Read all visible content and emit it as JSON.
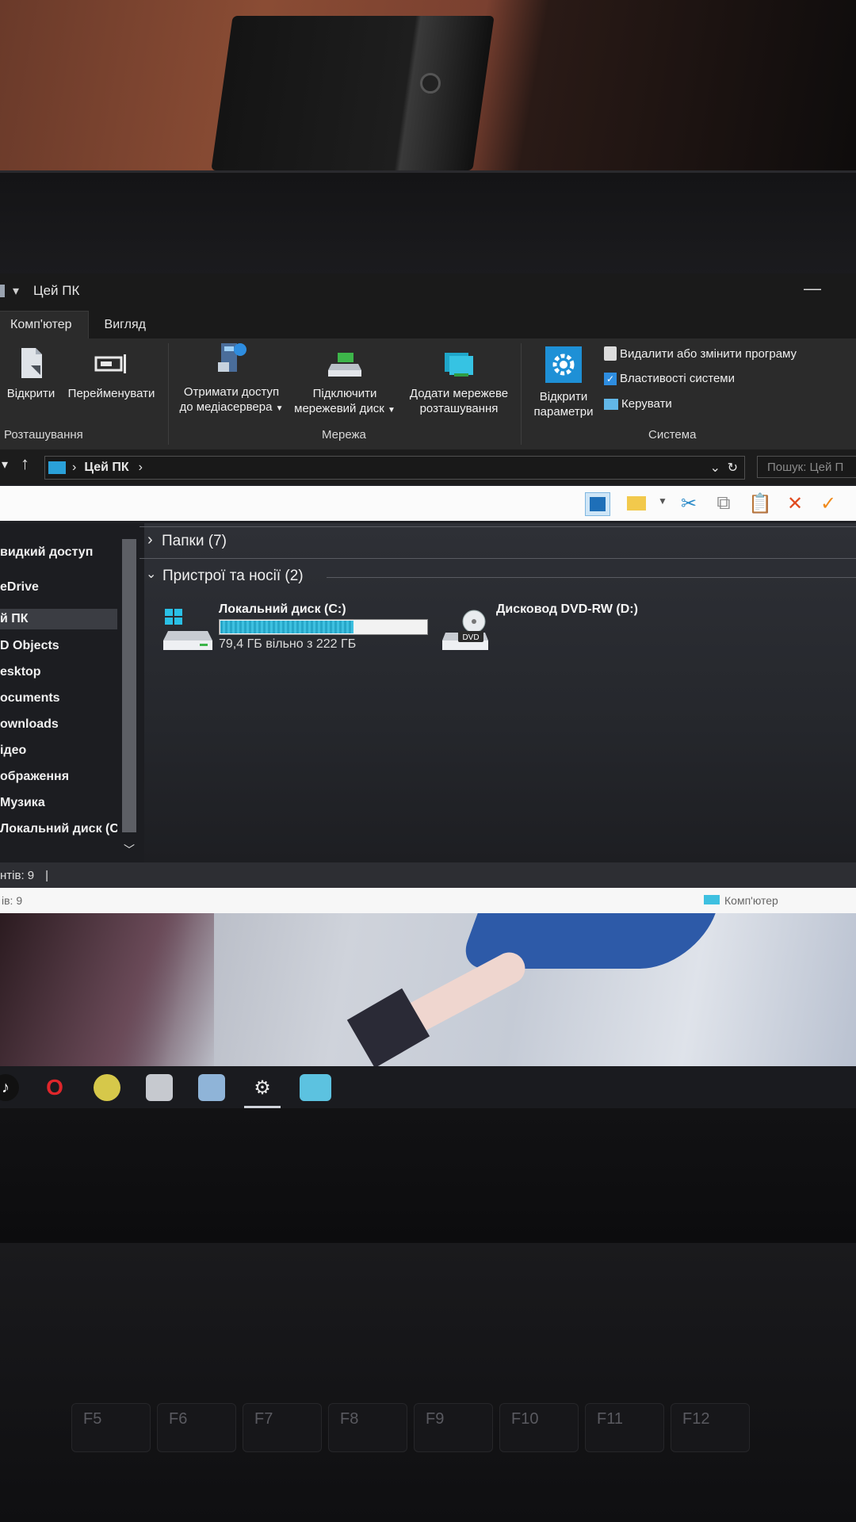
{
  "window": {
    "title": "Цей ПК",
    "qa_dropdown": "▾"
  },
  "tabs": [
    {
      "label": "Комп'ютер"
    },
    {
      "label": "Вигляд"
    }
  ],
  "ribbon": {
    "open_label": "Відкрити",
    "rename_label": "Перейменувати",
    "location_group": "Розташування",
    "media_l1": "Отримати доступ",
    "media_l2": "до медіасервера",
    "map_l1": "Підключити",
    "map_l2": "мережевий диск",
    "addloc_l1": "Додати мережеве",
    "addloc_l2": "розташування",
    "network_group": "Мережа",
    "settings_l1": "Відкрити",
    "settings_l2": "параметри",
    "uninstall_label": "Видалити або змінити програму",
    "sysprops_label": "Властивості системи",
    "manage_label": "Керувати",
    "system_group": "Система"
  },
  "address": {
    "path": "Цей ПК",
    "search_placeholder": "Пошук: Цей П"
  },
  "nav": {
    "items": [
      {
        "label": "видкий доступ"
      },
      {
        "label": "eDrive"
      },
      {
        "label": "й ПК"
      },
      {
        "label": "D Objects"
      },
      {
        "label": "esktop"
      },
      {
        "label": "ocuments"
      },
      {
        "label": "ownloads"
      },
      {
        "label": "ідео"
      },
      {
        "label": "ображення"
      },
      {
        "label": "Музика"
      },
      {
        "label": "Локальний диск (C:)"
      }
    ]
  },
  "content": {
    "folders_header": "Папки (7)",
    "devices_header": "Пристрої та носії (2)",
    "drive_c": {
      "name": "Локальний диск (C:)",
      "free_text": "79,4 ГБ вільно з 222 ГБ",
      "used_fraction": 0.64
    },
    "drive_d": {
      "name": "Дисковод DVD-RW (D:)",
      "badge": "DVD"
    }
  },
  "status": {
    "items_text": "нтів: 9",
    "items_text2": "ів: 9",
    "computer_label": "Комп'ютер"
  },
  "keyboard": {
    "fkeys": [
      "F5",
      "F6",
      "F7",
      "F8",
      "F9",
      "F10",
      "F11",
      "F12"
    ]
  },
  "colors": {
    "accent": "#1e90d6",
    "capacity": "#27a6c8",
    "delete_red": "#e04a1f",
    "check_orange": "#f08a1c"
  }
}
